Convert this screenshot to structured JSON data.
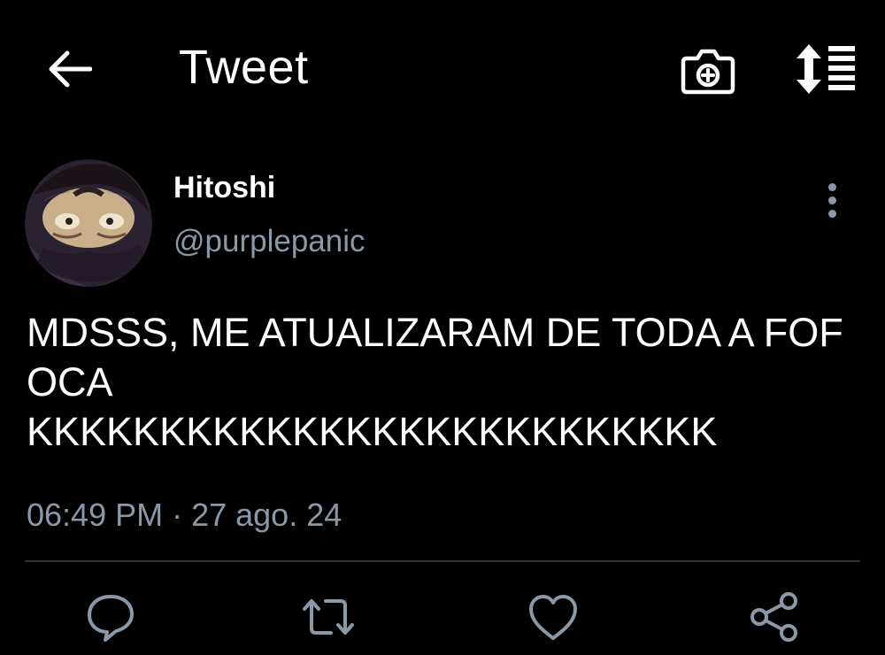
{
  "header": {
    "title": "Tweet",
    "back_icon": "arrow-left-icon",
    "camera_icon": "camera-plus-icon",
    "sort_icon": "sort-lines-icon"
  },
  "author": {
    "display_name": "Hitoshi",
    "handle": "@purplepanic",
    "avatar_icon": "avatar-image"
  },
  "tweet": {
    "text": "MDSSS, ME ATUALIZARAM DE TODA A FOFOCA\nKKKKKKKKKKKKKKKKKKKKKKKKKK",
    "timestamp": "06:49 PM · 27 ago. 24"
  },
  "actions": [
    {
      "name": "reply",
      "icon": "reply-bubble-icon"
    },
    {
      "name": "retweet",
      "icon": "retweet-icon"
    },
    {
      "name": "like",
      "icon": "heart-icon"
    },
    {
      "name": "share",
      "icon": "share-icon"
    }
  ],
  "colors": {
    "background": "#000000",
    "text": "#ffffff",
    "secondary": "#8b98a5",
    "divider": "#2f3336"
  }
}
